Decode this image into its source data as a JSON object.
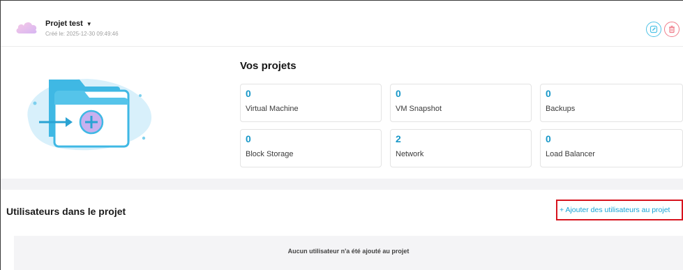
{
  "header": {
    "project_name": "Projet test",
    "created_at": "Créé le: 2025-12-30 09:49:46",
    "icons": {
      "cloud": "cloud-icon",
      "caret": "caret-down-icon",
      "edit": "edit-icon",
      "delete": "trash-icon"
    }
  },
  "projects": {
    "title": "Vos projets",
    "cards": [
      {
        "count": "0",
        "label": "Virtual Machine"
      },
      {
        "count": "0",
        "label": "VM Snapshot"
      },
      {
        "count": "0",
        "label": "Backups"
      },
      {
        "count": "0",
        "label": "Block Storage"
      },
      {
        "count": "2",
        "label": "Network"
      },
      {
        "count": "0",
        "label": "Load Balancer"
      }
    ]
  },
  "users": {
    "title": "Utilisateurs dans le projet",
    "add_link": "+ Ajouter des utilisateurs au projet",
    "empty_message": "Aucun utilisateur n'a été ajouté au projet"
  },
  "colors": {
    "accent": "#1797c8",
    "link": "#15a3d6",
    "highlight_border": "#d7131e",
    "edit_button": "#4ec3e6",
    "delete_button": "#f07c8a"
  }
}
